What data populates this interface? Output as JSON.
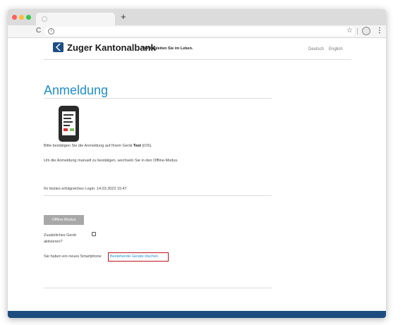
{
  "browser": {
    "new_tab": "+",
    "reload": "C",
    "info": "i",
    "bookmark": "☆",
    "menu": "⋮"
  },
  "header": {
    "brand_name": "Zuger Kantonalbank",
    "tagline": "Wir begleiten Sie im Leben.",
    "languages": [
      "Deutsch",
      "English"
    ]
  },
  "main": {
    "title": "Anmeldung",
    "confirm_prefix": "Bitte bestätigen Sie die Anmeldung auf Ihrem Gerät ",
    "device_name": "Test",
    "confirm_suffix": " (iOS).",
    "manual_hint": "Um die Anmeldung manuell zu bestätigen, wechseln Sie in den Offline-Modus.",
    "last_login": "Ihr letztes erfolgreiches Login: 14.03.2022 15:47",
    "offline_button": "Offline-Modus",
    "additional_device": "Zusätzliches Gerät aktivieren?",
    "new_phone_text": "Sie haben ein neues Smartphone",
    "delete_link": "Bestehende Geräte löschen"
  },
  "colors": {
    "accent": "#1f8dcc",
    "brand": "#1d4d85",
    "footer": "#1d4d7e",
    "highlight": "#c0121f"
  }
}
